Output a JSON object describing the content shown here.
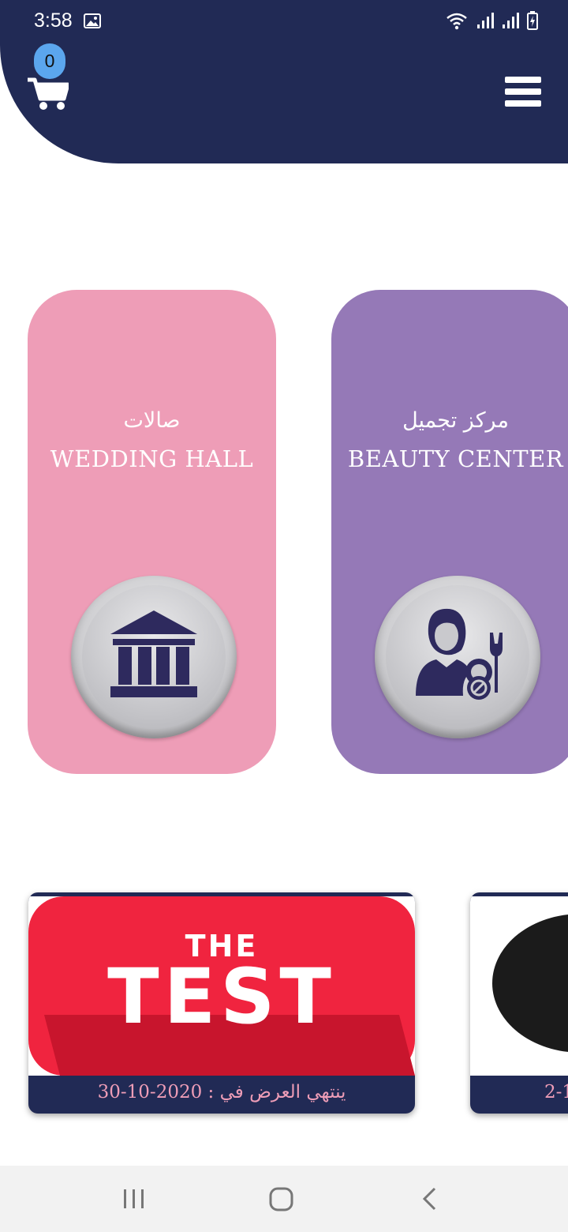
{
  "status_bar": {
    "time": "3:58"
  },
  "header": {
    "cart_count": "0"
  },
  "categories": [
    {
      "name_ar": "صالات",
      "name_en": "WEDDING HALL",
      "color": "#ee9db7",
      "icon": "building-icon"
    },
    {
      "name_ar": "مركز تجميل",
      "name_en": "BEAUTY CENTER",
      "color": "#9579b7",
      "icon": "woman-makeup-icon"
    }
  ],
  "offers": [
    {
      "image_text_top": "THE",
      "image_text_main": "TEST",
      "caption": "ينتهي العرض في : 2020-10-30"
    },
    {
      "caption": "2-1"
    }
  ],
  "colors": {
    "header": "#212a55",
    "badge": "#5ba6ee",
    "offer_red": "#f0243f"
  }
}
